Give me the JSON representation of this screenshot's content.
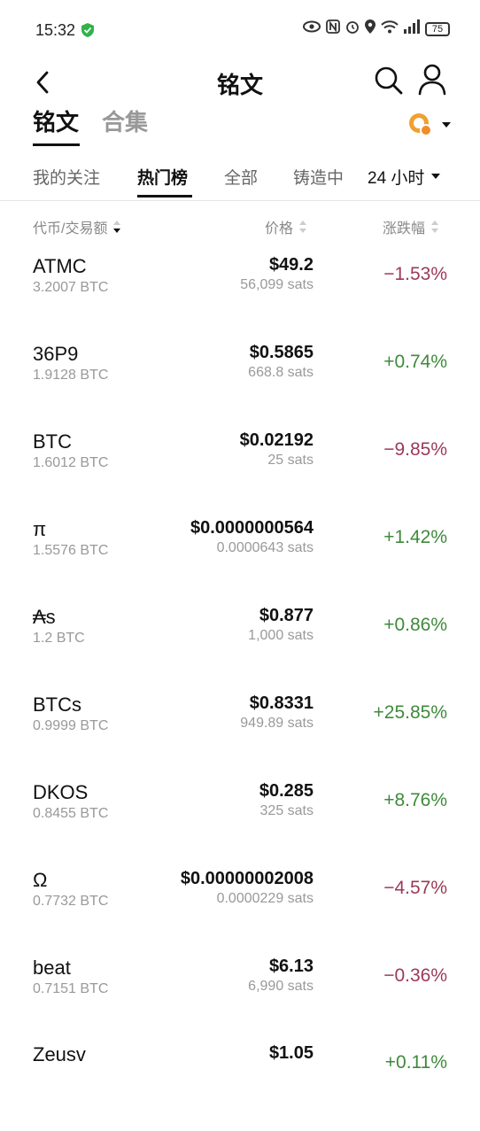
{
  "status_bar": {
    "time": "15:32",
    "battery": "75"
  },
  "header": {
    "title": "铭文"
  },
  "top_tabs": {
    "active": "铭文",
    "inactive": "合集"
  },
  "sub_tabs": [
    "我的关注",
    "热门榜",
    "全部",
    "铸造中"
  ],
  "period": "24 小时",
  "columns": {
    "token": "代币/交易额",
    "price": "价格",
    "change": "涨跌幅"
  },
  "colors": {
    "negative": "#9b3a57",
    "positive": "#3e8a3b",
    "accent": "#f0a030"
  },
  "rows": [
    {
      "symbol": "ATMC",
      "volume": "3.2007 BTC",
      "price": "$49.2",
      "sats": "56,099 sats",
      "change": "−1.53%",
      "dir": "neg"
    },
    {
      "symbol": "36P9",
      "volume": "1.9128 BTC",
      "price": "$0.5865",
      "sats": "668.8 sats",
      "change": "+0.74%",
      "dir": "pos"
    },
    {
      "symbol": "BTC",
      "volume": "1.6012 BTC",
      "price": "$0.02192",
      "sats": "25 sats",
      "change": "−9.85%",
      "dir": "neg"
    },
    {
      "symbol": "π",
      "volume": "1.5576 BTC",
      "price": "$0.0000000564",
      "sats": "0.0000643 sats",
      "change": "+1.42%",
      "dir": "pos"
    },
    {
      "symbol": "₳s",
      "volume": "1.2 BTC",
      "price": "$0.877",
      "sats": "1,000 sats",
      "change": "+0.86%",
      "dir": "pos"
    },
    {
      "symbol": "BTCs",
      "volume": "0.9999 BTC",
      "price": "$0.8331",
      "sats": "949.89 sats",
      "change": "+25.85%",
      "dir": "pos"
    },
    {
      "symbol": "DKOS",
      "volume": "0.8455 BTC",
      "price": "$0.285",
      "sats": "325 sats",
      "change": "+8.76%",
      "dir": "pos"
    },
    {
      "symbol": "Ω",
      "volume": "0.7732 BTC",
      "price": "$0.00000002008",
      "sats": "0.0000229 sats",
      "change": "−4.57%",
      "dir": "neg"
    },
    {
      "symbol": "beat",
      "volume": "0.7151 BTC",
      "price": "$6.13",
      "sats": "6,990 sats",
      "change": "−0.36%",
      "dir": "neg"
    },
    {
      "symbol": "Zeusv",
      "volume": "",
      "price": "$1.05",
      "sats": "",
      "change": "+0.11%",
      "dir": "pos"
    }
  ]
}
